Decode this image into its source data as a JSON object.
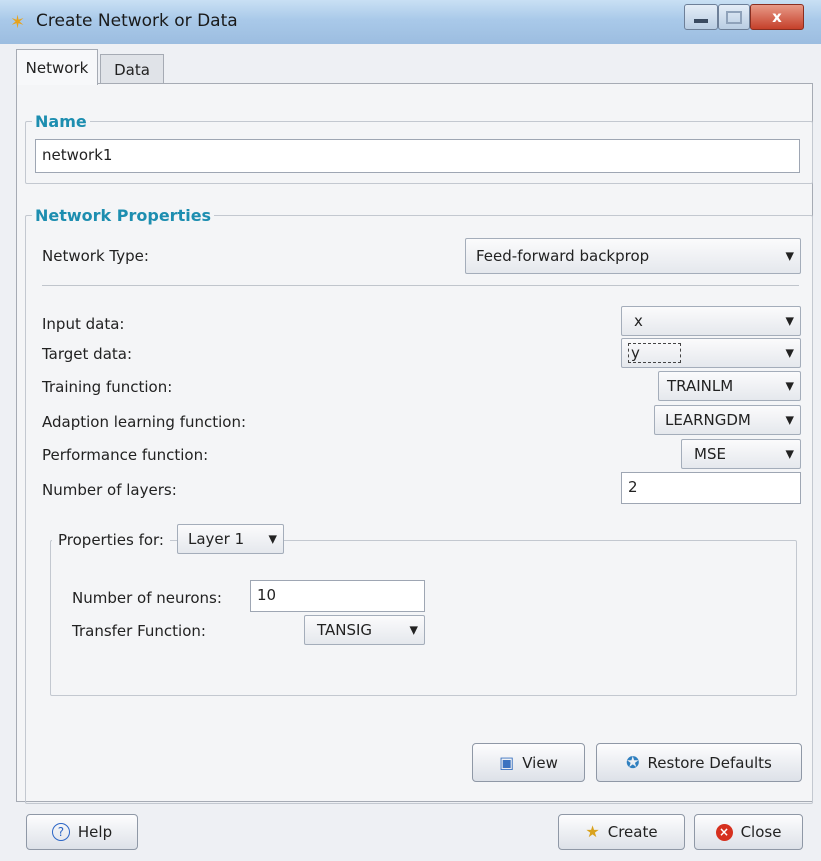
{
  "window": {
    "title": "Create Network or Data",
    "close_glyph": "x"
  },
  "tabs": [
    {
      "label": "Network",
      "active": true
    },
    {
      "label": "Data",
      "active": false
    }
  ],
  "name_group": {
    "legend": "Name",
    "value": "network1"
  },
  "props_group": {
    "legend": "Network Properties",
    "network_type_label": "Network Type:",
    "network_type_value": "Feed-forward backprop",
    "fields": {
      "input_data": {
        "label": "Input data:",
        "value": "x"
      },
      "target_data": {
        "label": "Target data:",
        "value": "y"
      },
      "training_function": {
        "label": "Training function:",
        "value": "TRAINLM"
      },
      "adaption_function": {
        "label": "Adaption learning function:",
        "value": "LEARNGDM"
      },
      "performance_function": {
        "label": "Performance function:",
        "value": "MSE"
      },
      "num_layers": {
        "label": "Number of layers:",
        "value": "2"
      }
    }
  },
  "layer_group": {
    "legend_label": "Properties for:",
    "layer_value": "Layer 1",
    "neurons_label": "Number of neurons:",
    "neurons_value": "10",
    "transfer_label": "Transfer Function:",
    "transfer_value": "TANSIG"
  },
  "buttons": {
    "view": "View",
    "restore": "Restore Defaults",
    "help": "Help",
    "create": "Create",
    "close": "Close"
  },
  "icons": {
    "app": "star-icon",
    "view": "window-icon",
    "restore": "restore-star-icon",
    "help": "help-icon",
    "create": "create-star-icon",
    "close": "close-circle-icon"
  },
  "colors": {
    "legend": "#1d8eb0",
    "titlebar": "#a9c9e9",
    "close_button": "#c5402a"
  }
}
